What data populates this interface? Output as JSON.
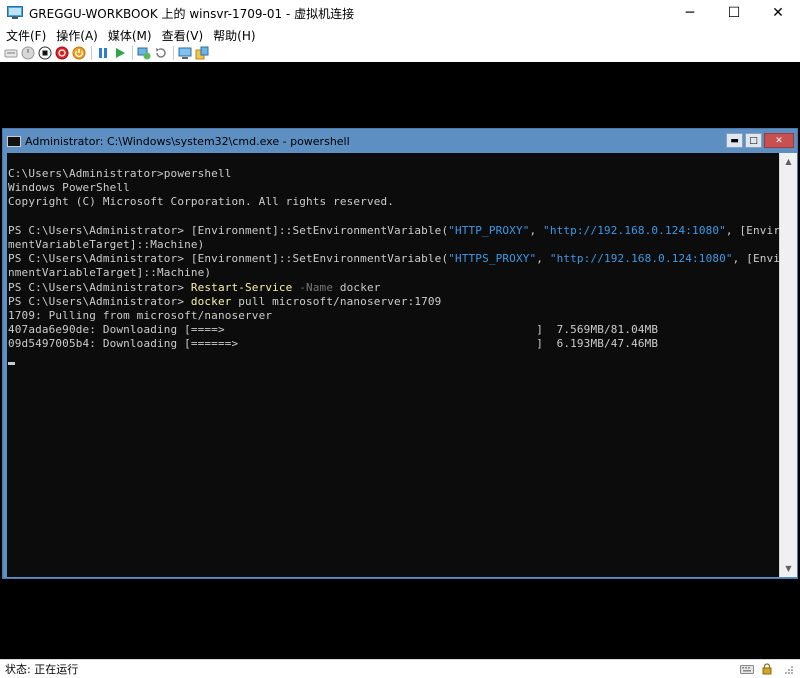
{
  "window": {
    "title": "GREGGU-WORKBOOK 上的 winsvr-1709-01 - 虚拟机连接",
    "minimize_glyph": "─",
    "maximize_glyph": "☐",
    "close_glyph": "✕"
  },
  "menu": {
    "items": [
      {
        "label": "文件(F)"
      },
      {
        "label": "操作(A)"
      },
      {
        "label": "媒体(M)"
      },
      {
        "label": "查看(V)"
      },
      {
        "label": "帮助(H)"
      }
    ]
  },
  "toolbar": {
    "icons": [
      "ctrl-alt-del-icon",
      "start-icon",
      "turn-off-icon",
      "shutdown-icon",
      "power-icon",
      "pause-icon",
      "resume-icon",
      "checkpoint-icon",
      "revert-icon",
      "enhanced-session-icon",
      "share-icon"
    ]
  },
  "console": {
    "title": "Administrator: C:\\Windows\\system32\\cmd.exe - powershell",
    "minimize_glyph": "▬",
    "maximize_glyph": "□",
    "close_glyph": "✕",
    "lines": [
      [
        {
          "t": "C:\\Users\\Administrator>powershell"
        }
      ],
      [
        {
          "t": "Windows PowerShell"
        }
      ],
      [
        {
          "t": "Copyright (C) Microsoft Corporation. All rights reserved."
        }
      ],
      [
        {
          "t": ""
        }
      ],
      [
        {
          "t": "PS C:\\Users\\Administrator> [Environment]::SetEnvironmentVariable("
        },
        {
          "t": "\"HTTP_PROXY\"",
          "c": "blue"
        },
        {
          "t": ", "
        },
        {
          "t": "\"http://192.168.0.124:1080\"",
          "c": "blue"
        },
        {
          "t": ", [Environ"
        }
      ],
      [
        {
          "t": "mentVariableTarget]::Machine)"
        }
      ],
      [
        {
          "t": "PS C:\\Users\\Administrator> [Environment]::SetEnvironmentVariable("
        },
        {
          "t": "\"HTTPS_PROXY\"",
          "c": "blue"
        },
        {
          "t": ", "
        },
        {
          "t": "\"http://192.168.0.124:1080\"",
          "c": "blue"
        },
        {
          "t": ", [Enviro"
        }
      ],
      [
        {
          "t": "nmentVariableTarget]::Machine)"
        }
      ],
      [
        {
          "t": "PS C:\\Users\\Administrator> "
        },
        {
          "t": "Restart-Service",
          "c": "yel"
        },
        {
          "t": " "
        },
        {
          "t": "-Name",
          "c": "gray"
        },
        {
          "t": " docker"
        }
      ],
      [
        {
          "t": "PS C:\\Users\\Administrator> "
        },
        {
          "t": "docker",
          "c": "yel"
        },
        {
          "t": " pull microsoft/nanoserver:1709"
        }
      ],
      [
        {
          "t": "1709: Pulling from microsoft/nanoserver"
        }
      ],
      [
        {
          "t": "407ada6e90de: Downloading [====>                                              ]  7.569MB/81.04MB"
        }
      ],
      [
        {
          "t": "09d5497005b4: Downloading [======>                                            ]  6.193MB/47.46MB"
        }
      ]
    ]
  },
  "status": {
    "label": "状态: 正在运行"
  },
  "colors": {
    "console_frame": "#5d8fc3",
    "terminal_bg": "#0c0c0c",
    "terminal_fg": "#cccccc",
    "ps_command": "#f9f1a5",
    "ps_parameter": "#767676",
    "ps_string": "#3b9ae8"
  }
}
